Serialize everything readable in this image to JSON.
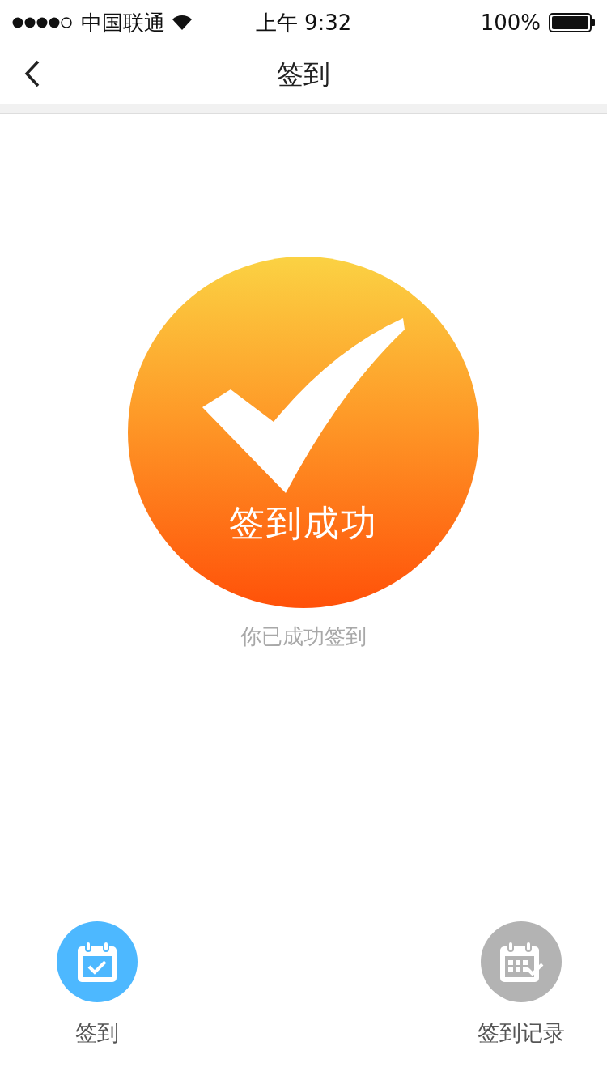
{
  "status_bar": {
    "carrier": "中国联通",
    "time": "上午 9:32",
    "battery": "100%"
  },
  "nav": {
    "title": "签到"
  },
  "result": {
    "title": "签到成功",
    "message": "你已成功签到"
  },
  "tabs": [
    {
      "kind": "checkin",
      "label": "签到",
      "selected": true
    },
    {
      "kind": "records",
      "label": "签到记录",
      "selected": false
    }
  ]
}
